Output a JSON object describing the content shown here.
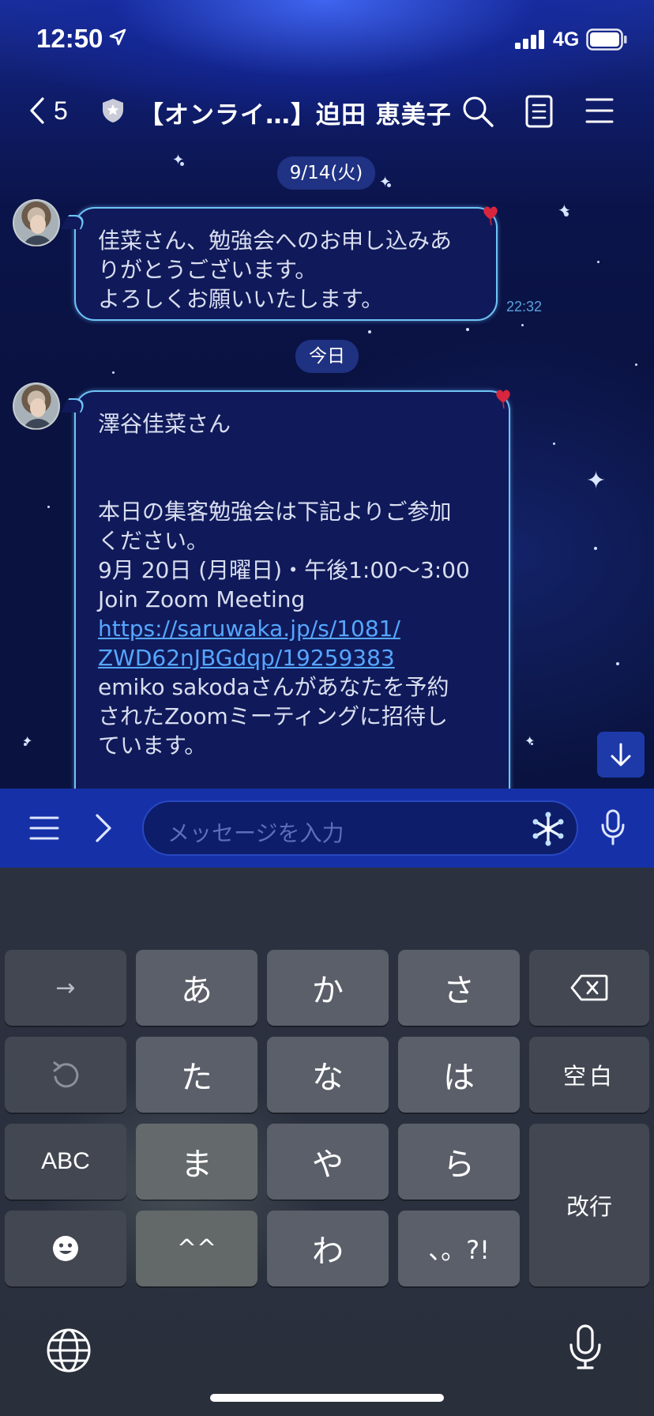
{
  "status_bar": {
    "time": "12:50",
    "network": "4G"
  },
  "header": {
    "back_count": "5",
    "title": "【オンライ…】迫田 恵美子"
  },
  "messages": {
    "date_1": "9/14(火)",
    "msg_1_lines": [
      "佳菜さん、勉強会へのお申し込みあ",
      "りがとうございます。",
      "よろしくお願いいたします。"
    ],
    "msg_1_time": "22:32",
    "date_2": "今日",
    "msg_2": {
      "greeting": "澤谷佳菜さん",
      "line_1": "本日の集客勉強会は下記よりご参加",
      "line_2": "ください。",
      "line_3": "9月 20日 (月曜日)・午後1:00～3:00",
      "line_4": "Join Zoom Meeting",
      "link_1": "https://saruwaka.jp/s/1081/",
      "link_2": "ZWD62nJBGdqp/19259383",
      "line_5": "emiko sakodaさんがあなたを予約",
      "line_6": "されたZoomミーティングに招待し",
      "line_7": "ています。"
    }
  },
  "input": {
    "placeholder": "メッセージを入力"
  },
  "keyboard": {
    "row1": [
      "→",
      "あ",
      "か",
      "さ",
      "⌫"
    ],
    "row2": [
      "↺",
      "た",
      "な",
      "は",
      "空白"
    ],
    "row3": [
      "ABC",
      "ま",
      "や",
      "ら"
    ],
    "row4": [
      "☻",
      "^^",
      "わ",
      "、。?!"
    ],
    "enter": "改行"
  },
  "colors": {
    "bubble_border": "#6fc4f6",
    "bubble_bg": "#101a5a",
    "link": "#56a6ff",
    "input_bar": "#1630a8"
  },
  "icons": [
    "location-arrow-icon",
    "signal-icon",
    "battery-icon",
    "back-chevron-icon",
    "shield-icon",
    "search-icon",
    "notes-icon",
    "menu-icon",
    "heart-icon",
    "scroll-down-icon",
    "snowflake-icon",
    "mic-icon",
    "globe-icon",
    "backspace-icon",
    "undo-icon",
    "emoji-icon"
  ]
}
